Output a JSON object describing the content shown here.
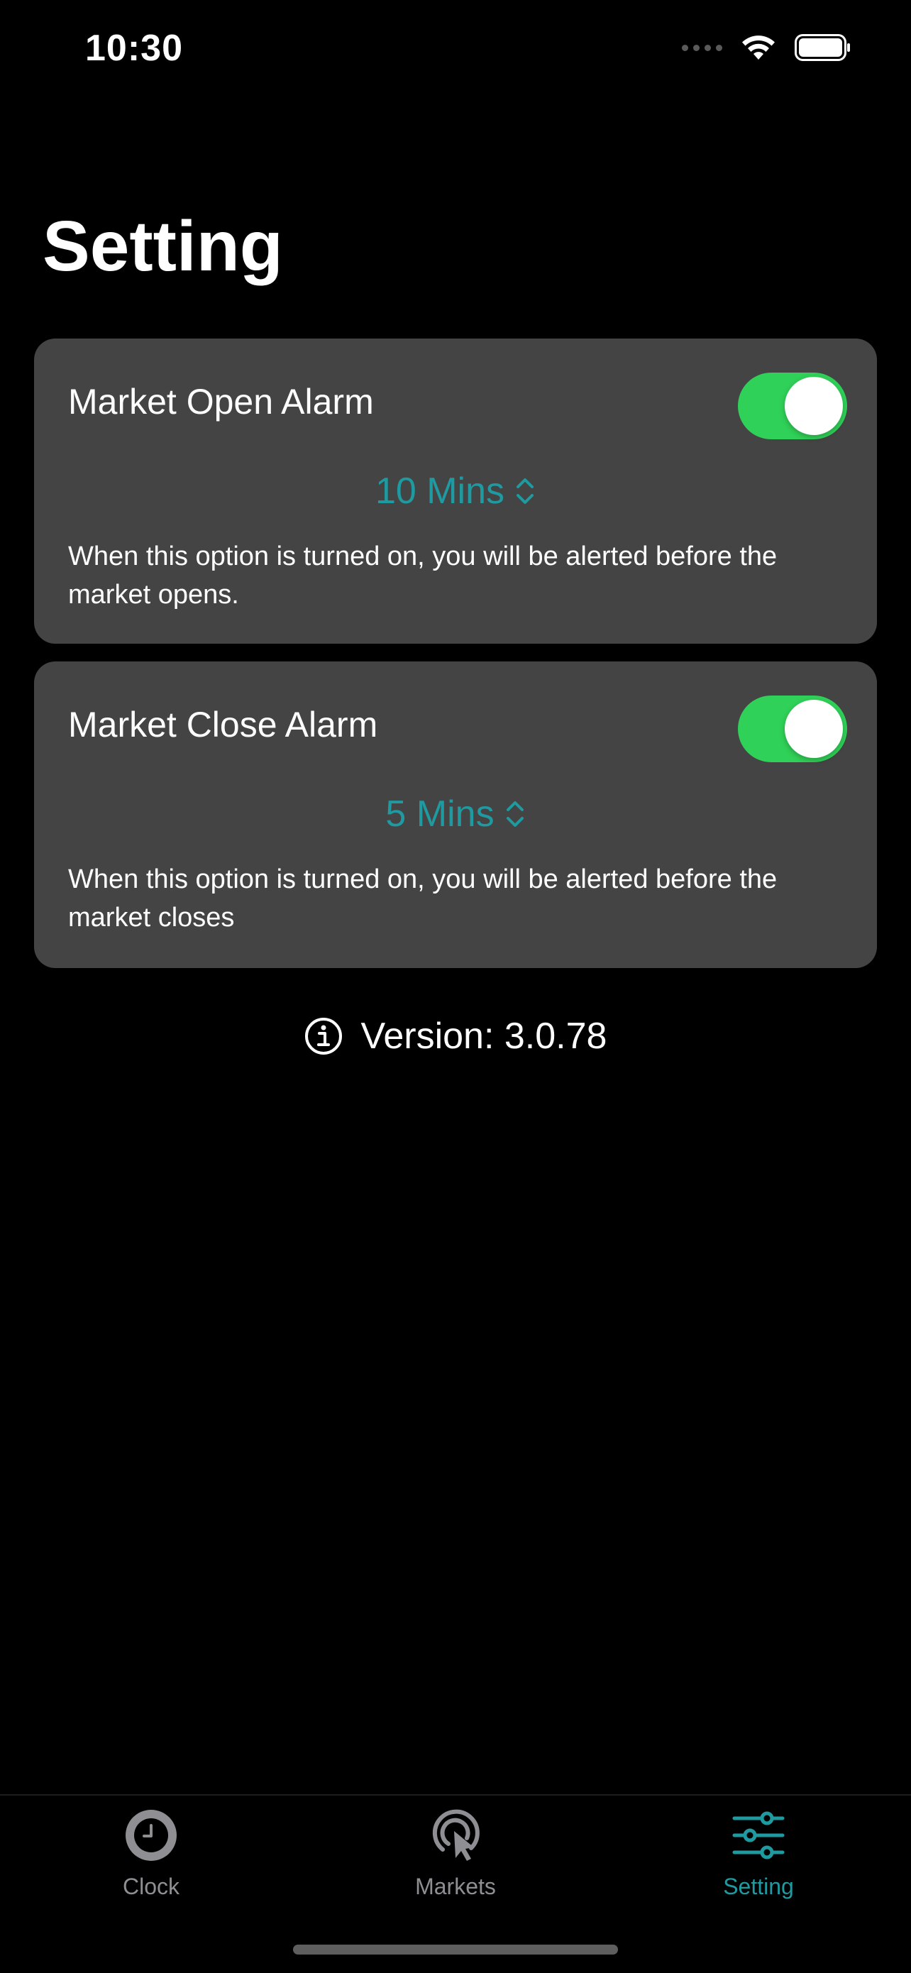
{
  "status_bar": {
    "time": "10:30"
  },
  "page": {
    "title": "Setting"
  },
  "alarms": [
    {
      "title": "Market Open Alarm",
      "enabled": true,
      "interval": "10 Mins",
      "description": "When this option is turned on, you will be alerted before the market opens."
    },
    {
      "title": "Market Close Alarm",
      "enabled": true,
      "interval": "5 Mins",
      "description": "When this option is turned on, you will be alerted before the market closes"
    }
  ],
  "version": {
    "text": "Version: 3.0.78",
    "icon": "info-circle-icon"
  },
  "tab_bar": {
    "tabs": [
      {
        "label": "Clock",
        "icon": "clock-icon",
        "active": false
      },
      {
        "label": "Markets",
        "icon": "cursor-click-icon",
        "active": false
      },
      {
        "label": "Setting",
        "icon": "sliders-icon",
        "active": true
      }
    ]
  },
  "colors": {
    "background": "#000000",
    "card": "#444444",
    "toggle_on": "#30d158",
    "accent": "#1e9aa0",
    "inactive_tab": "#8e8e93"
  }
}
